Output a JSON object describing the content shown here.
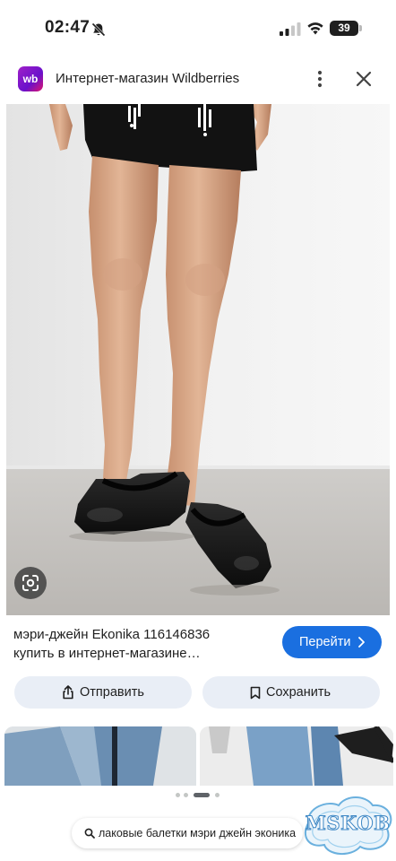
{
  "status_bar": {
    "time": "02:47",
    "battery": "39",
    "battery_level": 0.39,
    "icons": [
      "bell-muted-icon",
      "signal-icon",
      "wifi-icon",
      "battery-icon"
    ]
  },
  "source": {
    "logo_text": "wb",
    "title": "Интернет-магазин Wildberries",
    "icons": [
      "more-vert-icon",
      "close-icon"
    ]
  },
  "product": {
    "caption_line1": "мэри-джейн Ekonika 116146836",
    "caption_line2": "купить в интернет-магазине…",
    "visit_label": "Перейти",
    "lens_icon": "google-lens-icon"
  },
  "actions": {
    "share_label": "Отправить",
    "save_label": "Сохранить",
    "share_icon": "share-icon",
    "save_icon": "bookmark-icon"
  },
  "search": {
    "query": "лаковые балетки мэри джейн эконика",
    "icon": "search-icon"
  },
  "pager": {
    "count": 4,
    "active_index": 2
  },
  "watermark": {
    "text": "MSKOB"
  },
  "colors": {
    "accent": "#1a6fe0",
    "chip_bg": "#e9eef6",
    "wb_brand": "#a020c8"
  }
}
